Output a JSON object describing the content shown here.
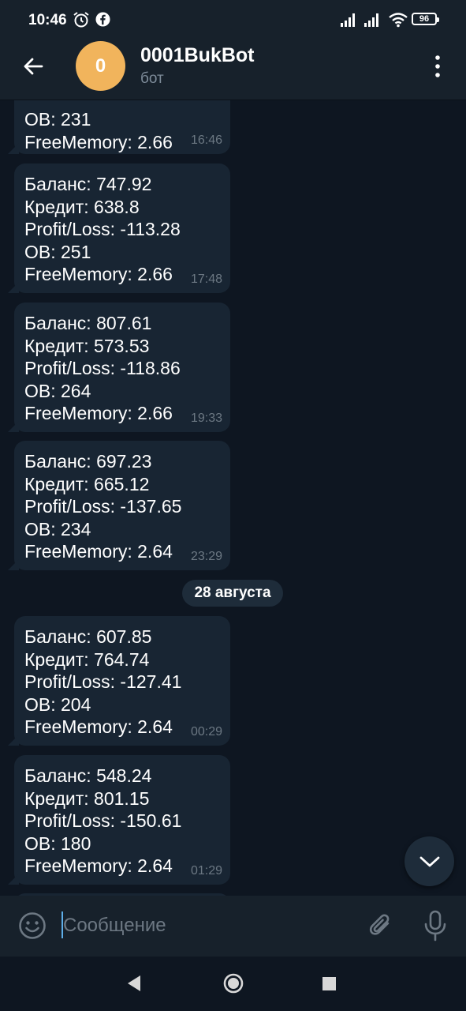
{
  "status_bar": {
    "time": "10:46",
    "battery": "96"
  },
  "header": {
    "avatar_letter": "0",
    "title": "0001BukBot",
    "subtitle": "бот",
    "avatar_color": "#f1b45c"
  },
  "messages": [
    {
      "lines": [
        "ОВ: 231",
        "FreeMemory: 2.66"
      ],
      "time": "16:46"
    },
    {
      "lines": [
        "Баланс: 747.92",
        "Кредит: 638.8",
        "Profit/Loss: -113.28",
        "ОВ: 251",
        "FreeMemory: 2.66"
      ],
      "time": "17:48"
    },
    {
      "lines": [
        "Баланс: 807.61",
        "Кредит: 573.53",
        "Profit/Loss: -118.86",
        "ОВ: 264",
        "FreeMemory: 2.66"
      ],
      "time": "19:33"
    },
    {
      "lines": [
        "Баланс: 697.23",
        "Кредит: 665.12",
        "Profit/Loss: -137.65",
        "ОВ: 234",
        "FreeMemory: 2.64"
      ],
      "time": "23:29"
    },
    {
      "lines": [
        "Баланс: 607.85",
        "Кредит: 764.74",
        "Profit/Loss: -127.41",
        "ОВ: 204",
        "FreeMemory: 2.64"
      ],
      "time": "00:29"
    },
    {
      "lines": [
        "Баланс: 548.24",
        "Кредит: 801.15",
        "Profit/Loss: -150.61",
        "ОВ: 180",
        "FreeMemory: 2.64"
      ],
      "time": "01:29"
    }
  ],
  "date_separator": "28 августа",
  "composer": {
    "placeholder": "Сообщение"
  },
  "icons": {
    "back": "arrow-left-icon",
    "menu": "more-vertical-icon",
    "scroll": "chevron-down-icon",
    "emoji": "smile-icon",
    "attach": "paperclip-icon",
    "mic": "microphone-icon"
  },
  "colors": {
    "background": "#0e1621",
    "bar": "#17212b",
    "bubble": "#182533",
    "accent": "#5eaee8"
  }
}
